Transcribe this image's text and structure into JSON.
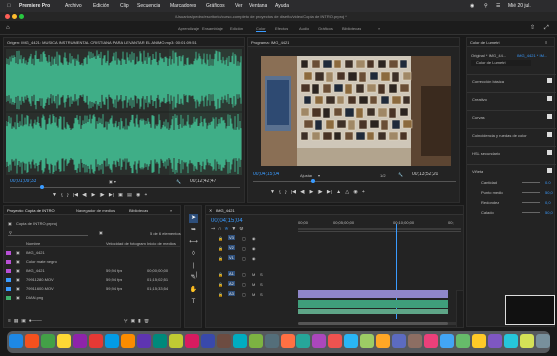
{
  "menubar": {
    "app_name": "Premiere Pro",
    "menus": [
      "Archivo",
      "Edición",
      "Clip",
      "Secuencia",
      "Marcadores",
      "Gráficos",
      "Ver",
      "Ventana",
      "Ayuda"
    ],
    "clock": "Mié 20 jul."
  },
  "titlebar": {
    "path": "/Usuarios/pedro/escritorio/curso-completo de proyectos de diseño/video/Copia de INTRO.prproj *"
  },
  "workspaces": [
    "Aprendizaje",
    "Ensamblaje",
    "Edición",
    "Color",
    "Efectos",
    "Audio",
    "Gráficos",
    "Bibliotecas"
  ],
  "active_workspace": "Color",
  "source": {
    "title": "Origen: IMG_4421: MUSICA INSTRUMENTAL CRISTIANA PARA LEVANTAR EL ANIMO.mp3: 00:01:09:51",
    "timecode": "00;01;09;33",
    "duration": "00;12;42;47",
    "wave_color": "#3fae87"
  },
  "program": {
    "title": "Programa: IMG_4421",
    "timecode": "00;04;15;04",
    "fit": "Ajustar",
    "quality": "1/2",
    "duration": "00;13;52;20"
  },
  "lumetri": {
    "title": "Color de Lumetri",
    "master": "Original * IMG_44...",
    "master_target": "IMG_4421 * IM...",
    "effect": "Color de Lumetri",
    "sections": [
      "Corrección básica",
      "Creativo",
      "Curvas",
      "Coincidencia y ruedas de color",
      "HSL secundario",
      "Viñeta"
    ],
    "vignette": [
      {
        "label": "Cantidad",
        "value": "0.0"
      },
      {
        "label": "Punto medio",
        "value": "50,0"
      },
      {
        "label": "Redondez",
        "value": "0,0"
      },
      {
        "label": "Calado",
        "value": "50,0"
      }
    ]
  },
  "project": {
    "tabs": [
      "Proyecto: Copia de INTRO",
      "Navegador de medios",
      "Bibliotecas"
    ],
    "file": "Copia de INTRO.prproj",
    "count": "5 de 6 elementos",
    "columns": [
      "Nombre",
      "Velocidad de fotogramas",
      "Inicio de medios"
    ],
    "items": [
      {
        "name": "IMG_4421",
        "fps": "",
        "start": "",
        "color": "#b84fd6"
      },
      {
        "name": "Color mate negro",
        "fps": "",
        "start": "",
        "color": "#b84fd6"
      },
      {
        "name": "IMG_4421",
        "fps": "59,94 fps",
        "start": "00;00;00;00",
        "color": "#b84fd6"
      },
      {
        "name": "79911280.MOV",
        "fps": "59,94 fps",
        "start": "01;15;02;51",
        "color": "#3a9bff"
      },
      {
        "name": "79911600.MOV",
        "fps": "59,94 fps",
        "start": "01;15;33;54",
        "color": "#3a9bff"
      },
      {
        "name": "DIAN.png",
        "fps": "",
        "start": "",
        "color": "#3fb26b"
      }
    ]
  },
  "timeline": {
    "tab": "IMG_4421",
    "timecode": "00;04;15;04",
    "ruler": [
      "00;00",
      "00;05;00;00",
      "00;10;00;00",
      "00;"
    ],
    "video_tracks": [
      "V3",
      "V2",
      "V1"
    ],
    "audio_tracks": [
      "A1",
      "A2",
      "A3"
    ]
  }
}
